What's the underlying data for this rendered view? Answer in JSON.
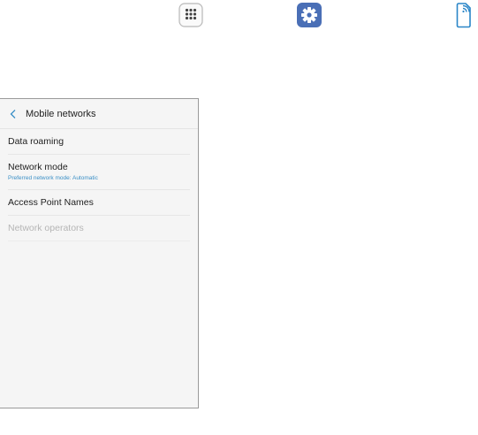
{
  "top_icons": [
    {
      "icon": "apps-grid-icon"
    },
    {
      "icon": "settings-gear-icon"
    },
    {
      "icon": "mobile-network-device-icon"
    }
  ],
  "screen": {
    "title": "Mobile networks",
    "back_icon": "chevron-left-icon",
    "items": [
      {
        "label": "Data roaming",
        "sublabel": "",
        "enabled": true
      },
      {
        "label": "Network mode",
        "sublabel": "Preferred network mode: Automatic",
        "enabled": true
      },
      {
        "label": "Access Point Names",
        "sublabel": "",
        "enabled": true
      },
      {
        "label": "Network operators",
        "sublabel": "",
        "enabled": false
      }
    ]
  },
  "colors": {
    "accent": "#3a8fc6",
    "settings_icon_bg": "#4a6fb6",
    "screen_bg": "#f5f5f5",
    "disabled_text": "#b5b5b5"
  }
}
